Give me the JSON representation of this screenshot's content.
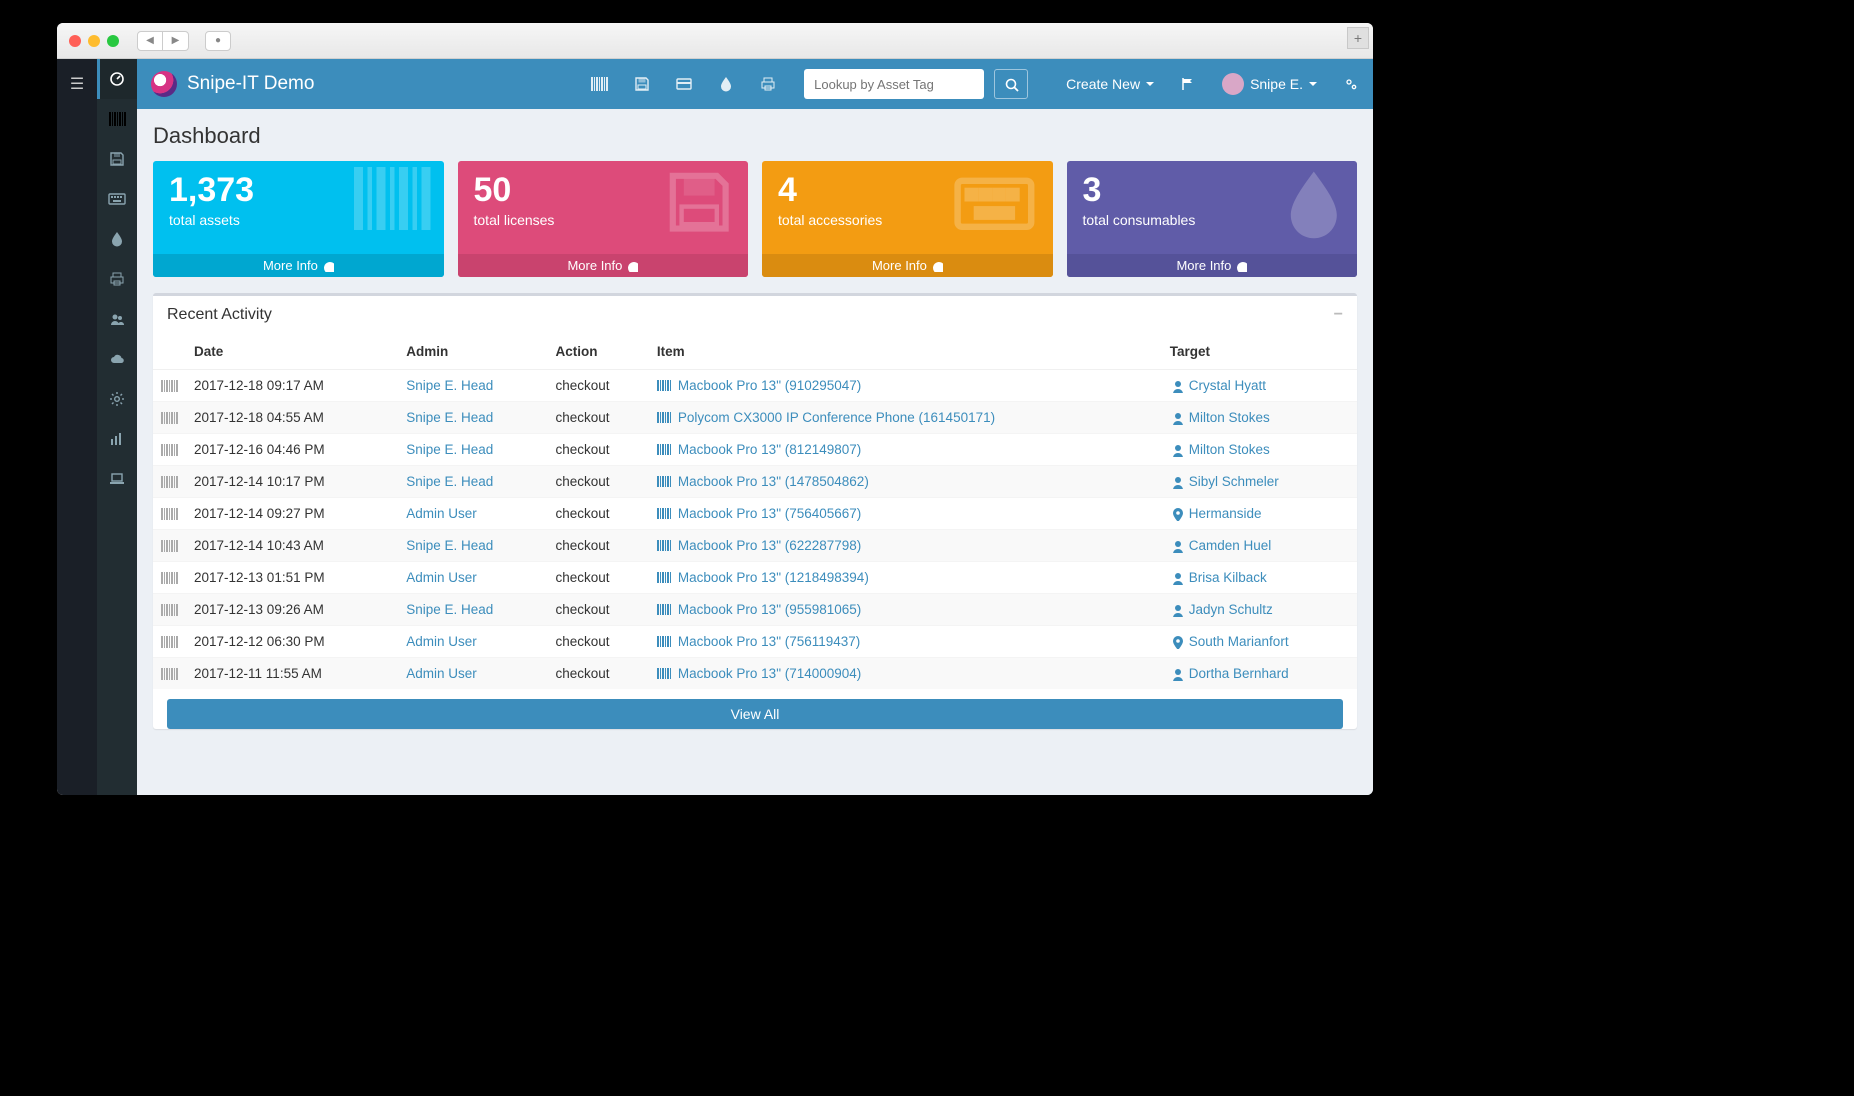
{
  "app_title": "Snipe-IT Demo",
  "search": {
    "placeholder": "Lookup by Asset Tag"
  },
  "topbar": {
    "create_new": "Create New",
    "user_name": "Snipe E."
  },
  "page": {
    "title": "Dashboard"
  },
  "stats": {
    "assets": {
      "value": "1,373",
      "label": "total assets",
      "more": "More Info"
    },
    "licenses": {
      "value": "50",
      "label": "total licenses",
      "more": "More Info"
    },
    "accessories": {
      "value": "4",
      "label": "total accessories",
      "more": "More Info"
    },
    "consumables": {
      "value": "3",
      "label": "total consumables",
      "more": "More Info"
    }
  },
  "recent": {
    "title": "Recent Activity",
    "view_all": "View All",
    "columns": {
      "date": "Date",
      "admin": "Admin",
      "action": "Action",
      "item": "Item",
      "target": "Target"
    },
    "rows": [
      {
        "date": "2017-12-18 09:17 AM",
        "admin": "Snipe E. Head",
        "action": "checkout",
        "item": "Macbook Pro 13\" (910295047)",
        "target": "Crystal Hyatt",
        "target_icon": "user"
      },
      {
        "date": "2017-12-18 04:55 AM",
        "admin": "Snipe E. Head",
        "action": "checkout",
        "item": "Polycom CX3000 IP Conference Phone (161450171)",
        "target": "Milton Stokes",
        "target_icon": "user"
      },
      {
        "date": "2017-12-16 04:46 PM",
        "admin": "Snipe E. Head",
        "action": "checkout",
        "item": "Macbook Pro 13\" (812149807)",
        "target": "Milton Stokes",
        "target_icon": "user"
      },
      {
        "date": "2017-12-14 10:17 PM",
        "admin": "Snipe E. Head",
        "action": "checkout",
        "item": "Macbook Pro 13\" (1478504862)",
        "target": "Sibyl Schmeler",
        "target_icon": "user"
      },
      {
        "date": "2017-12-14 09:27 PM",
        "admin": "Admin User",
        "action": "checkout",
        "item": "Macbook Pro 13\" (756405667)",
        "target": "Hermanside",
        "target_icon": "location"
      },
      {
        "date": "2017-12-14 10:43 AM",
        "admin": "Snipe E. Head",
        "action": "checkout",
        "item": "Macbook Pro 13\" (622287798)",
        "target": "Camden Huel",
        "target_icon": "user"
      },
      {
        "date": "2017-12-13 01:51 PM",
        "admin": "Admin User",
        "action": "checkout",
        "item": "Macbook Pro 13\" (1218498394)",
        "target": "Brisa Kilback",
        "target_icon": "user"
      },
      {
        "date": "2017-12-13 09:26 AM",
        "admin": "Snipe E. Head",
        "action": "checkout",
        "item": "Macbook Pro 13\" (955981065)",
        "target": "Jadyn Schultz",
        "target_icon": "user"
      },
      {
        "date": "2017-12-12 06:30 PM",
        "admin": "Admin User",
        "action": "checkout",
        "item": "Macbook Pro 13\" (756119437)",
        "target": "South Marianfort",
        "target_icon": "location"
      },
      {
        "date": "2017-12-11 11:55 AM",
        "admin": "Admin User",
        "action": "checkout",
        "item": "Macbook Pro 13\" (714000904)",
        "target": "Dortha Bernhard",
        "target_icon": "user"
      }
    ]
  }
}
